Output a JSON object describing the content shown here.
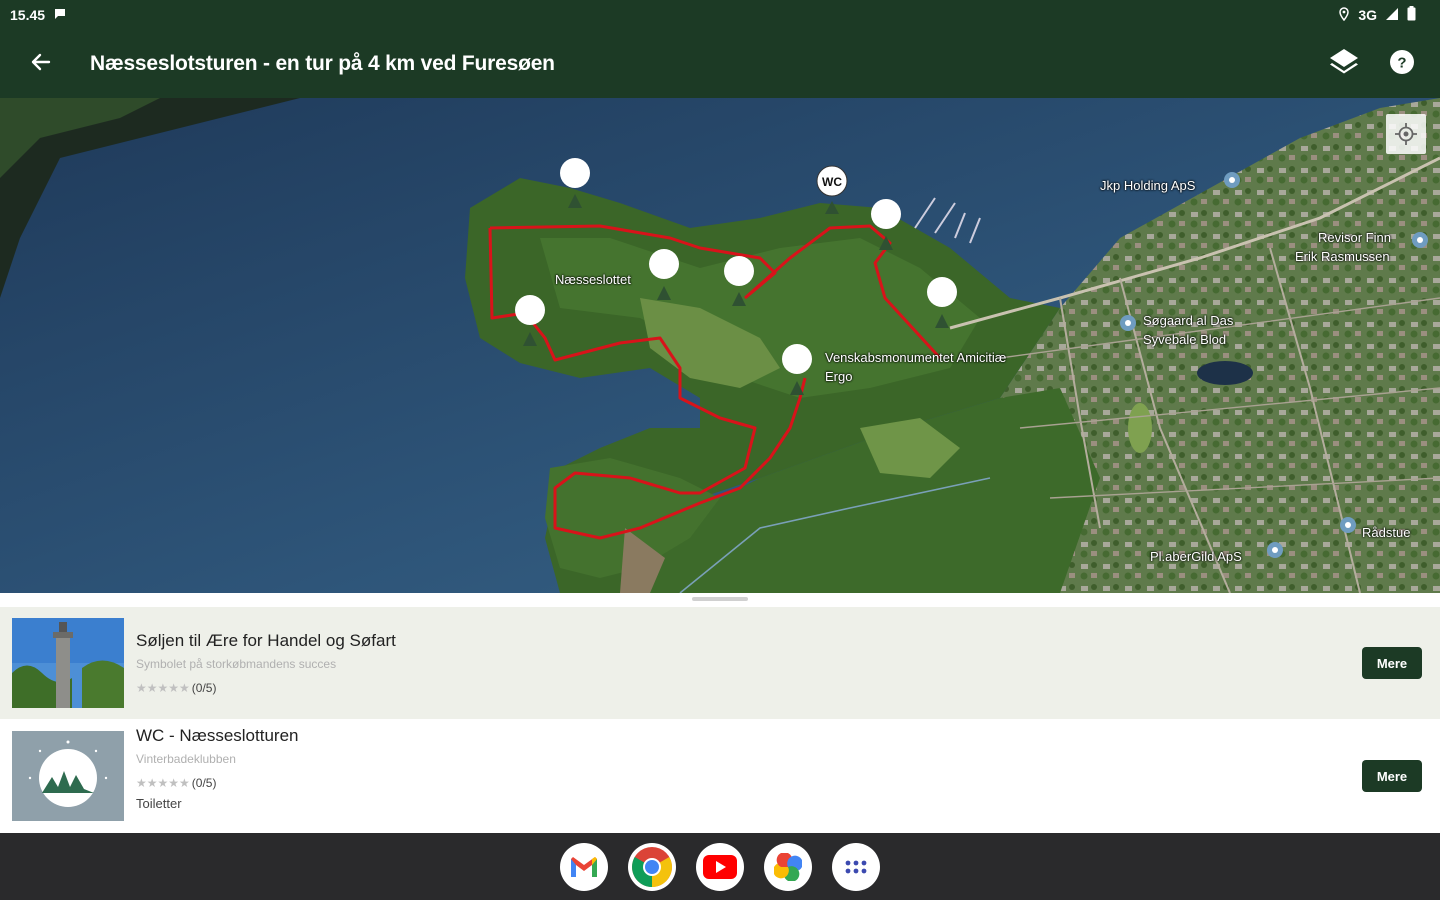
{
  "status": {
    "time": "15.45",
    "network": "3G"
  },
  "app_bar": {
    "title": "Næsseslotsturen - en tur på 4 km ved Furesøen",
    "icons": [
      "back-arrow-icon",
      "layers-icon",
      "help-icon"
    ]
  },
  "map": {
    "labels": {
      "naesseslottet": "Næsseslottet",
      "monument": "Venskabsmonumentet Amicitiæ",
      "monument2": "Ergo",
      "jkp": "Jkp Holding ApS",
      "rasmussen1": "Revisor Finn",
      "rasmussen2": "Erik Rasmussen",
      "sognehus1": "Søgaard al Das",
      "sognehus2": "Syvebale Blod",
      "raadhus": "Rådstue",
      "consult": "Pl.aberGild ApS"
    },
    "wc_marker": "WC",
    "colors": {
      "route": "#d8131a",
      "water": "#2a4a6e",
      "forest": "#3f6b2a"
    }
  },
  "sheet": {
    "items": [
      {
        "title": "Søljen til Ære for Handel og Søfart",
        "subtitle": "Symbolet på storkøbmandens succes",
        "rating": "(0/5)",
        "category": "",
        "button": "Mere"
      },
      {
        "title": "WC - Næsseslotturen",
        "subtitle": "Vinterbadeklubben",
        "rating": "(0/5)",
        "category": "Toiletter",
        "button": "Mere"
      }
    ]
  },
  "dock": {
    "apps": [
      "gmail-icon",
      "chrome-icon",
      "youtube-icon",
      "photos-icon",
      "app-drawer-icon"
    ]
  }
}
